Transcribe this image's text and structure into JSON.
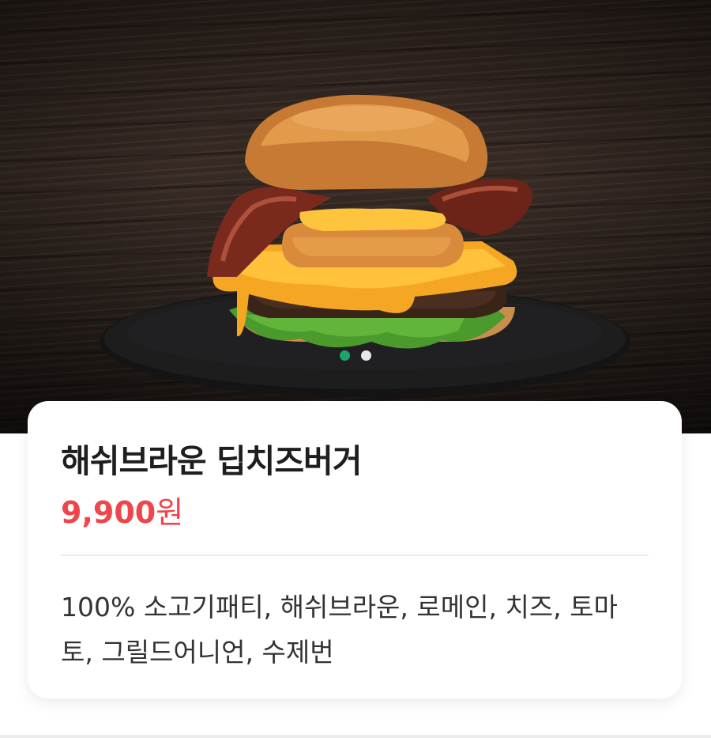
{
  "hero": {
    "image_label": "burger-photo",
    "pager": {
      "count": 2,
      "active_index": 0,
      "active_color": "#1aa66b",
      "inactive_color": "#e8e8e8"
    }
  },
  "product": {
    "name": "해쉬브라운 딥치즈버거",
    "price_amount": "9,900",
    "price_unit": "원",
    "description": "100% 소고기패티, 해쉬브라운, 로메인, 치즈, 토마토, 그릴드어니언, 수제번"
  },
  "colors": {
    "price": "#f0454b",
    "title": "#1e1e1e",
    "text": "#333333"
  }
}
